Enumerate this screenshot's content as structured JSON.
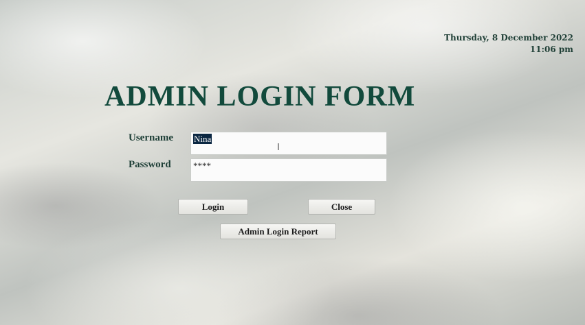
{
  "header": {
    "date": "Thursday, 8 December 2022",
    "time": "11:06 pm"
  },
  "form": {
    "title": "ADMIN LOGIN FORM",
    "username_label": "Username",
    "username_value": "Nina",
    "password_label": "Password",
    "password_value": "****"
  },
  "buttons": {
    "login": "Login",
    "close": "Close",
    "report": "Admin Login Report"
  },
  "colors": {
    "title": "#124a3c",
    "selection": "#0b2742"
  }
}
